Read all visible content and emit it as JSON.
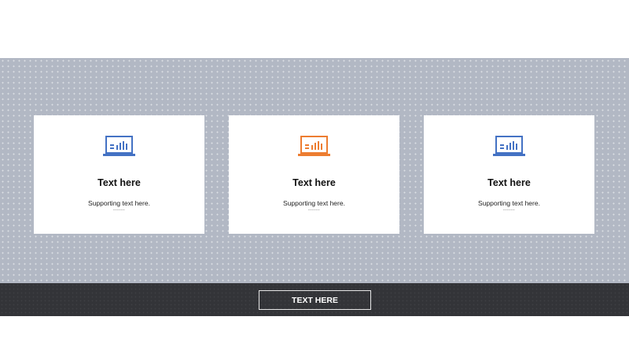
{
  "colors": {
    "band_bg": "#b2b8c4",
    "footer_bg": "#333438",
    "icon_blue": "#4472c4",
    "icon_orange": "#ed7d31"
  },
  "cards": [
    {
      "icon": "laptop-chart-icon",
      "icon_color": "#4472c4",
      "title": "Text here",
      "subtitle": "Supporting text here.",
      "more": "------"
    },
    {
      "icon": "laptop-chart-icon",
      "icon_color": "#ed7d31",
      "title": "Text here",
      "subtitle": "Supporting text here.",
      "more": "------"
    },
    {
      "icon": "laptop-chart-icon",
      "icon_color": "#4472c4",
      "title": "Text here",
      "subtitle": "Supporting text here.",
      "more": "------"
    }
  ],
  "footer": {
    "button_label": "TEXT HERE"
  }
}
